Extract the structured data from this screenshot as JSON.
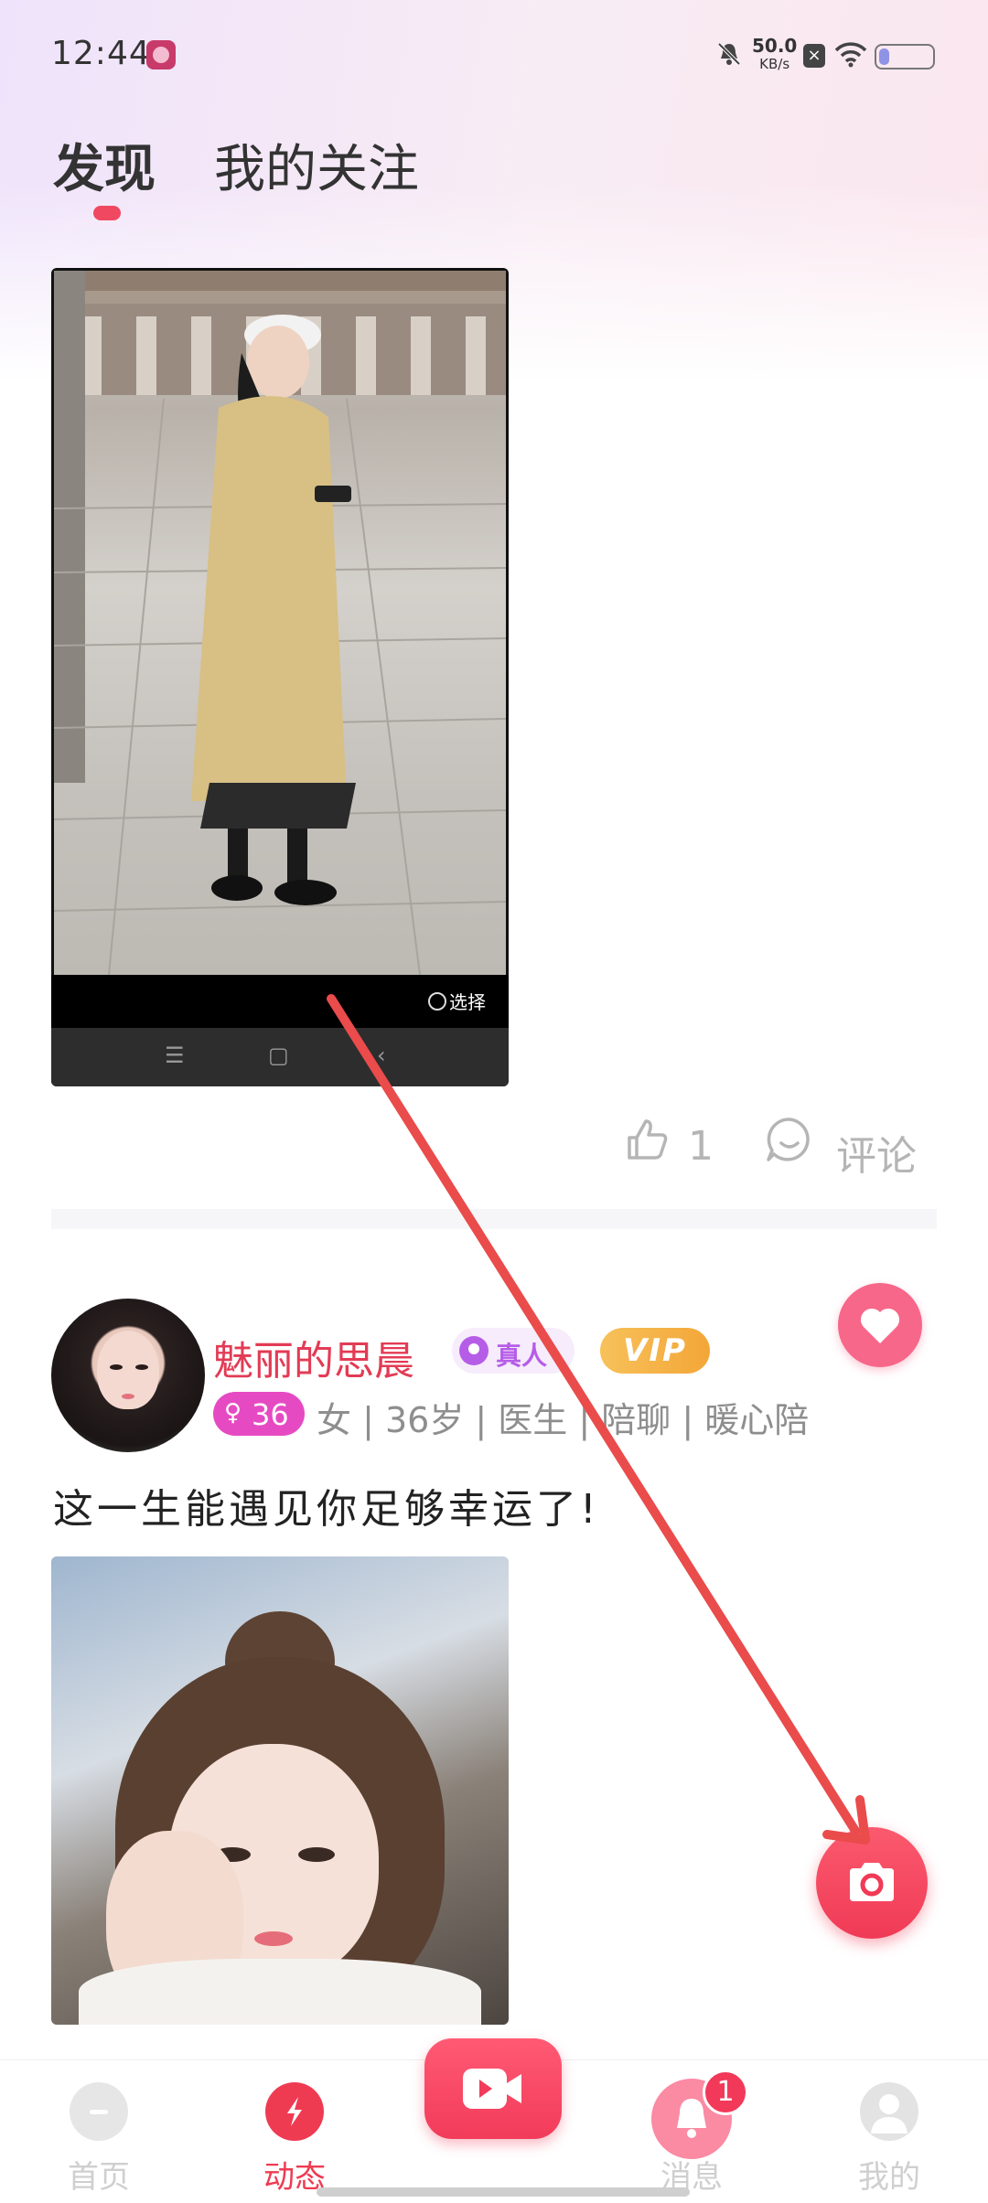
{
  "status_bar": {
    "time": "12:44",
    "net_speed_value": "50.0",
    "net_speed_unit": "KB/s",
    "battery_level": 0.2,
    "icons": [
      "app-icon",
      "bell-off-icon",
      "sim-off-icon",
      "wifi-icon",
      "battery-icon"
    ]
  },
  "tabs": [
    {
      "label": "发现",
      "active": true
    },
    {
      "label": "我的关注",
      "active": false
    }
  ],
  "post1": {
    "screenshot_select_label": "选择",
    "nav_glyphs": [
      "☰",
      "▢",
      "‹"
    ],
    "like_count": "1",
    "comment_label": "评论"
  },
  "post2": {
    "username": "魅丽的思晨",
    "verified_label": "真人",
    "vip_label": "VIP",
    "gender_symbol": "♀",
    "age_badge": "36",
    "meta": "女 | 36岁 | 医生 | 陪聊 | 暖心陪",
    "text": "这一生能遇见你足够幸运了!"
  },
  "bottom_nav": {
    "items": [
      {
        "label": "首页",
        "active": false
      },
      {
        "label": "动态",
        "active": true
      },
      {
        "label": "",
        "active": false
      },
      {
        "label": "消息",
        "active": false,
        "badge": "1"
      },
      {
        "label": "我的",
        "active": false
      }
    ]
  },
  "colors": {
    "accent": "#ef3b52",
    "vip": "#f3a638",
    "verified": "#b65de8",
    "gender": "#e64ac3",
    "annotation_arrow": "#ea4b4b"
  }
}
